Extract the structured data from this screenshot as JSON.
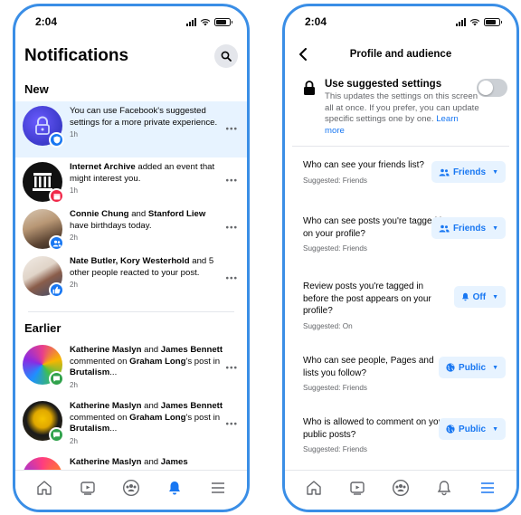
{
  "status_bar": {
    "time": "2:04"
  },
  "notifications_screen": {
    "title": "Notifications",
    "new_label": "New",
    "earlier_label": "Earlier",
    "new_items": [
      {
        "segments": [
          "You can use Facebook's suggested settings for a more private experience."
        ],
        "time": "1h",
        "badge": "shield-icon"
      },
      {
        "segments": [
          "Internet Archive",
          " added an event that might interest you."
        ],
        "time": "1h",
        "badge": "calendar-icon"
      },
      {
        "segments": [
          "Connie Chung",
          " and ",
          "Stanford Liew",
          " have birthdays today."
        ],
        "time": "2h",
        "badge": "people-icon"
      },
      {
        "segments": [
          "Nate Butler, Kory Westerhold",
          " and 5 other people reacted to your post."
        ],
        "time": "2h",
        "badge": "like-icon"
      }
    ],
    "earlier_items": [
      {
        "segments": [
          "Katherine Maslyn",
          " and ",
          "James Bennett",
          " commented on ",
          "Graham Long",
          "'s post in ",
          "Brutalism",
          "..."
        ],
        "time": "2h",
        "badge": "comment-icon"
      },
      {
        "segments": [
          "Katherine Maslyn",
          " and ",
          "James Bennett",
          " commented on ",
          "Graham Long",
          "'s post in ",
          "Brutalism",
          "..."
        ],
        "time": "2h",
        "badge": "comment-icon"
      },
      {
        "segments": [
          "Katherine Maslyn",
          " and ",
          "James"
        ],
        "time": "",
        "badge": "comment-icon"
      }
    ]
  },
  "profile_screen": {
    "title": "Profile and audience",
    "suggested": {
      "title": "Use suggested settings",
      "description": "This updates the settings on this screen all at once. If you prefer, you can update specific settings one by one.",
      "link": "Learn more",
      "toggle_on": false
    },
    "settings": [
      {
        "question": "Who can see your friends list?",
        "suggested": "Suggested: Friends",
        "value": "Friends",
        "icon": "friends-icon"
      },
      {
        "question": "Who can see posts you're tagged in on your profile?",
        "suggested": "Suggested: Friends",
        "value": "Friends",
        "icon": "friends-icon"
      },
      {
        "question": "Review posts you're tagged in before the post appears on your profile?",
        "suggested": "Suggested: On",
        "value": "Off",
        "icon": "bell-icon"
      },
      {
        "question": "Who can see people, Pages and lists you follow?",
        "suggested": "Suggested: Friends",
        "value": "Public",
        "icon": "globe-icon"
      },
      {
        "question": "Who is allowed to comment on your public posts?",
        "suggested": "Suggested: Friends",
        "value": "Public",
        "icon": "globe-icon"
      }
    ]
  },
  "colors": {
    "accent": "#1877f2",
    "highlight_bg": "#e7f3ff",
    "phone_frame": "#3a8ee6",
    "secondary_text": "#65676b"
  }
}
